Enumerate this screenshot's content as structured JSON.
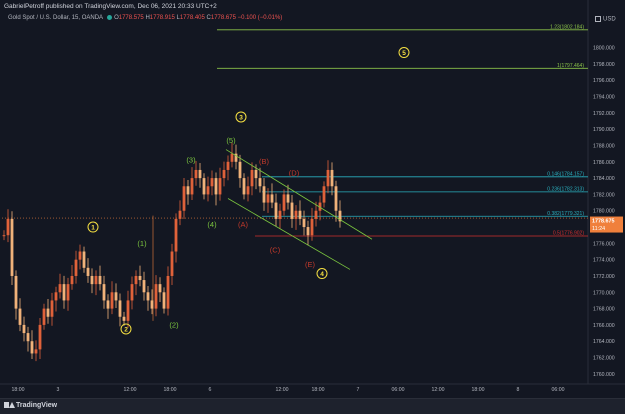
{
  "header": {
    "published": "GabrielPetroff published on TradingView.com, Dec 06, 2021 20:33 UTC+2",
    "symbol": "Gold Spot / U.S. Dollar, 15, OANDA",
    "o_label": "O",
    "o_value": "1778.575",
    "h_label": "H",
    "h_value": "1778.915",
    "l_label": "L",
    "l_value": "1778.405",
    "c_label": "C",
    "c_value": "1778.675",
    "change": "−0.100 (−0.01%)"
  },
  "currency": "USD",
  "footer": {
    "brand": "TradingView"
  },
  "colors": {
    "background": "#131722",
    "up": "#e0623a",
    "down": "#f0b27a",
    "wave_yellow": "#f5e042",
    "wave_green": "#7cc73f",
    "wave_red": "#c0392b",
    "fib_cyan": "#2ab0bf",
    "fib_green": "#8bc34a",
    "fib_red": "#d32f2f",
    "price_tag": "#f0803c"
  },
  "chart_data": {
    "type": "candlestick",
    "y_range": [
      1759,
      1804
    ],
    "y_ticks": [
      "1760.000",
      "1762.000",
      "1764.000",
      "1766.000",
      "1768.000",
      "1770.000",
      "1772.000",
      "1774.000",
      "1776.000",
      "1778.000",
      "1780.000",
      "1782.000",
      "1784.000",
      "1786.000",
      "1788.000",
      "1790.000",
      "1792.000",
      "1794.000",
      "1796.000",
      "1798.000",
      "1800.000"
    ],
    "x_ticks": [
      "18:00",
      "3",
      "12:00",
      "18:00",
      "6",
      "12:00",
      "18:00",
      "7",
      "06:00",
      "12:00",
      "18:00",
      "8",
      "06:00"
    ],
    "current_price": "1778.675",
    "countdown": "11:24",
    "fib_levels": [
      {
        "label": "1.23(1802.184)",
        "value": 1802.184,
        "color": "green"
      },
      {
        "label": "1(1797.464)",
        "value": 1797.464,
        "color": "green"
      },
      {
        "label": "0.146(1784.157)",
        "value": 1784.157,
        "color": "cyan"
      },
      {
        "label": "0.236(1782.313)",
        "value": 1782.313,
        "color": "cyan"
      },
      {
        "label": "0.382(1779.321)",
        "value": 1779.321,
        "color": "cyan"
      },
      {
        "label": "0.5(1776.902)",
        "value": 1776.902,
        "color": "red"
      }
    ],
    "wave_labels": [
      {
        "text": "1",
        "style": "yellow-circle"
      },
      {
        "text": "2",
        "style": "yellow-circle"
      },
      {
        "text": "3",
        "style": "yellow-circle"
      },
      {
        "text": "4",
        "style": "yellow-circle"
      },
      {
        "text": "5",
        "style": "yellow-circle"
      },
      {
        "text": "(1)",
        "style": "green"
      },
      {
        "text": "(2)",
        "style": "green"
      },
      {
        "text": "(3)",
        "style": "green"
      },
      {
        "text": "(4)",
        "style": "green"
      },
      {
        "text": "(5)",
        "style": "green"
      },
      {
        "text": "(A)",
        "style": "red"
      },
      {
        "text": "(B)",
        "style": "red"
      },
      {
        "text": "(C)",
        "style": "red"
      },
      {
        "text": "(D)",
        "style": "red"
      },
      {
        "text": "(E)",
        "style": "red"
      }
    ]
  }
}
